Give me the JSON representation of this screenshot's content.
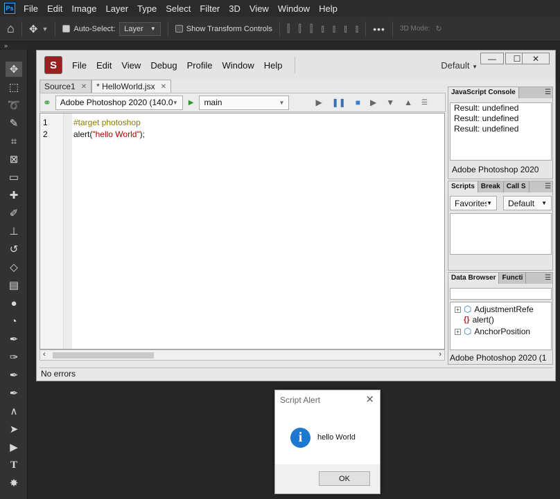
{
  "ps": {
    "logo": "Ps",
    "menu": [
      "File",
      "Edit",
      "Image",
      "Layer",
      "Type",
      "Select",
      "Filter",
      "3D",
      "View",
      "Window",
      "Help"
    ],
    "options": {
      "auto_select_label": "Auto-Select:",
      "auto_select_target": "Layer",
      "show_transform_label": "Show Transform Controls",
      "mode_label": "3D Mode:"
    },
    "collapse_glyph": "»"
  },
  "estk": {
    "logo": "S",
    "menu": [
      "File",
      "Edit",
      "View",
      "Debug",
      "Profile",
      "Window",
      "Help"
    ],
    "workspace": "Default",
    "tabs": [
      {
        "label": "Source1"
      },
      {
        "label": "* HelloWorld.jsx"
      }
    ],
    "target_app": "Adobe Photoshop 2020 (140.0",
    "engine": "main",
    "code_lines": [
      {
        "num": "1",
        "directive": "#target photoshop"
      },
      {
        "num": "2",
        "fn": "alert(",
        "str": "\"hello World\"",
        "end": ");"
      }
    ],
    "status": "No errors"
  },
  "panels": {
    "console": {
      "tab": "JavaScript Console",
      "lines": [
        "Result: undefined",
        "Result: undefined",
        "Result: undefined"
      ],
      "footer": "Adobe Photoshop 2020"
    },
    "scripts": {
      "tabs": [
        "Scripts",
        "Break",
        "Call S"
      ],
      "favorites": "Favorites",
      "default": "Default"
    },
    "data_browser": {
      "tabs": [
        "Data Browser",
        "Functi"
      ],
      "items": [
        "AdjustmentRefe",
        "alert()",
        "AnchorPosition"
      ],
      "footer": "Adobe Photoshop 2020 (1"
    }
  },
  "alert": {
    "title": "Script Alert",
    "message": "hello World",
    "ok": "OK"
  },
  "colors": {
    "ps_bg": "#262626",
    "accent_blue": "#1e78d2",
    "code_string": "#b00000",
    "code_directive": "#8a7a00"
  }
}
